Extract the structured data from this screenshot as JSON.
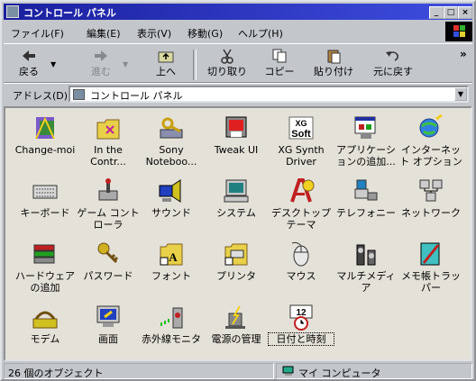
{
  "window": {
    "title": "コントロール パネル"
  },
  "menu": [
    "ファイル(F)",
    "編集(E)",
    "表示(V)",
    "移動(G)",
    "ヘルプ(H)"
  ],
  "toolbar": {
    "back": "戻る",
    "forward": "進む",
    "up": "上へ",
    "cut": "切り取り",
    "copy": "コピー",
    "paste": "貼り付け",
    "undo": "元に戻す"
  },
  "address": {
    "label": "アドレス(D)",
    "value": "コントロール パネル"
  },
  "items": [
    {
      "label": "Change-moi",
      "icon": "change-moi-icon"
    },
    {
      "label": "In the Contr...",
      "icon": "folder-icon"
    },
    {
      "label": "Sony Noteboo...",
      "icon": "sony-notebook-icon"
    },
    {
      "label": "Tweak UI",
      "icon": "tweak-ui-icon"
    },
    {
      "label": "XG Synth Driver",
      "icon": "xg-soft-icon"
    },
    {
      "label": "アプリケーションの追加...",
      "icon": "add-remove-programs-icon"
    },
    {
      "label": "インターネット オプション",
      "icon": "internet-options-icon"
    },
    {
      "label": "キーボード",
      "icon": "keyboard-icon"
    },
    {
      "label": "ゲーム コントローラ",
      "icon": "game-controller-icon"
    },
    {
      "label": "サウンド",
      "icon": "sound-icon"
    },
    {
      "label": "システム",
      "icon": "system-icon"
    },
    {
      "label": "デスクトップ テーマ",
      "icon": "desktop-themes-icon"
    },
    {
      "label": "テレフォニー",
      "icon": "telephony-icon"
    },
    {
      "label": "ネットワーク",
      "icon": "network-icon"
    },
    {
      "label": "ハードウェアの追加",
      "icon": "add-hardware-icon"
    },
    {
      "label": "パスワード",
      "icon": "passwords-icon"
    },
    {
      "label": "フォント",
      "icon": "fonts-icon"
    },
    {
      "label": "プリンタ",
      "icon": "printers-icon"
    },
    {
      "label": "マウス",
      "icon": "mouse-icon"
    },
    {
      "label": "マルチメディア",
      "icon": "multimedia-icon"
    },
    {
      "label": "メモ帳トラッパー",
      "icon": "notepad-trapper-icon"
    },
    {
      "label": "モデム",
      "icon": "modem-icon"
    },
    {
      "label": "画面",
      "icon": "display-icon"
    },
    {
      "label": "赤外線モニタ",
      "icon": "infrared-monitor-icon"
    },
    {
      "label": "電源の管理",
      "icon": "power-management-icon"
    },
    {
      "label": "日付と時刻",
      "icon": "date-time-icon"
    }
  ],
  "status": {
    "count": "26 個のオブジェクト",
    "location": "マイ コンピュータ"
  }
}
